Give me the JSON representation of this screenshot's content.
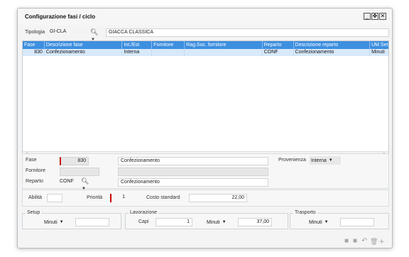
{
  "window": {
    "title": "Configurazione fasi / ciclo",
    "controls": [
      "_",
      "✥",
      "✕"
    ]
  },
  "tipologia": {
    "label": "Tipologia",
    "code": "GI-CLA",
    "description": "GIACCA CLASSICA"
  },
  "grid": {
    "columns": [
      "Fase",
      "Descrizione fase",
      "Int./Est",
      "Fornitore",
      "Rag.Soc. fornitore",
      "Reparto",
      "Descrizione reparto",
      "UM Set"
    ],
    "rows": [
      [
        "830",
        "Confezionamento",
        "Interna",
        "",
        "",
        "CONF",
        "Confezionamento",
        "Minuti"
      ]
    ]
  },
  "detail": {
    "fase_label": "Fase",
    "fase_value": "830",
    "fase_desc": "Confezionamento",
    "fornitore_label": "Fornitore",
    "fornitore_value": "",
    "fornitore_desc": "",
    "reparto_label": "Reparto",
    "reparto_value": "CONF",
    "reparto_desc": "Confezionamento",
    "provenienza_label": "Provenienza",
    "provenienza_value": "Interna"
  },
  "params": {
    "abilita_label": "Abilità",
    "abilita_value": "",
    "priorita_label": "Priorità",
    "priorita_value": "1",
    "costo_label": "Costo standard",
    "costo_value": "22,00"
  },
  "setup": {
    "legend": "Setup",
    "unit": "Minuti",
    "value": ""
  },
  "lavorazione": {
    "legend": "Lavorazione",
    "capi_label": "Capi",
    "capi_value": "1",
    "unit": "Minuti",
    "value": "37,00"
  },
  "trasporto": {
    "legend": "Trasporto",
    "unit": "Minuti",
    "value": ""
  },
  "toolbar": {
    "first": "■",
    "last": "■",
    "undo": "↶",
    "delete": "🗑",
    "add": "+"
  }
}
